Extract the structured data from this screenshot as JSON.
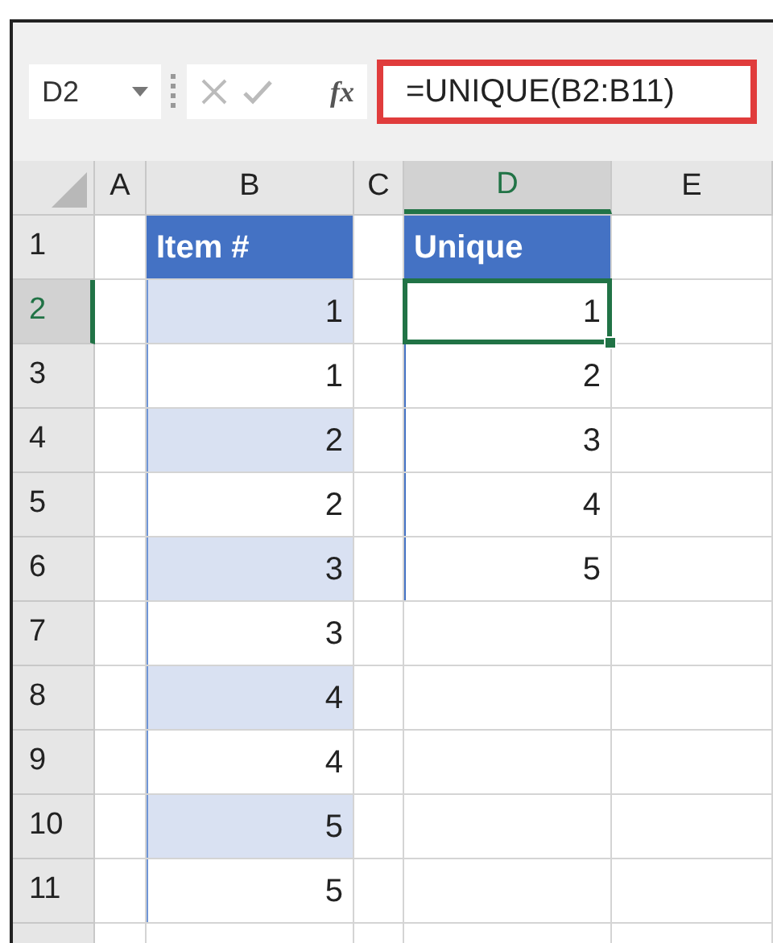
{
  "formula_bar": {
    "name_box": "D2",
    "function_label": "fx",
    "formula": "=UNIQUE(B2:B11)",
    "highlighted": true
  },
  "columns": [
    {
      "label": "A",
      "selected": false
    },
    {
      "label": "B",
      "selected": false
    },
    {
      "label": "C",
      "selected": false
    },
    {
      "label": "D",
      "selected": true
    },
    {
      "label": "E",
      "selected": false
    }
  ],
  "rows": [
    {
      "label": "1",
      "selected": false,
      "cells": [
        {
          "kind": "empty"
        },
        {
          "kind": "header",
          "text": "Item #"
        },
        {
          "kind": "empty"
        },
        {
          "kind": "header",
          "text": "Unique"
        },
        {
          "kind": "empty"
        }
      ]
    },
    {
      "label": "2",
      "selected": true,
      "cells": [
        {
          "kind": "empty"
        },
        {
          "kind": "band",
          "text": "1"
        },
        {
          "kind": "empty"
        },
        {
          "kind": "spill",
          "text": "1",
          "active": true
        },
        {
          "kind": "empty"
        }
      ]
    },
    {
      "label": "3",
      "selected": false,
      "cells": [
        {
          "kind": "empty"
        },
        {
          "kind": "plain",
          "text": "1"
        },
        {
          "kind": "empty"
        },
        {
          "kind": "spill",
          "text": "2",
          "active": false
        },
        {
          "kind": "empty"
        }
      ]
    },
    {
      "label": "4",
      "selected": false,
      "cells": [
        {
          "kind": "empty"
        },
        {
          "kind": "band",
          "text": "2"
        },
        {
          "kind": "empty"
        },
        {
          "kind": "spill",
          "text": "3",
          "active": false
        },
        {
          "kind": "empty"
        }
      ]
    },
    {
      "label": "5",
      "selected": false,
      "cells": [
        {
          "kind": "empty"
        },
        {
          "kind": "plain",
          "text": "2"
        },
        {
          "kind": "empty"
        },
        {
          "kind": "spill",
          "text": "4",
          "active": false
        },
        {
          "kind": "empty"
        }
      ]
    },
    {
      "label": "6",
      "selected": false,
      "cells": [
        {
          "kind": "empty"
        },
        {
          "kind": "band",
          "text": "3"
        },
        {
          "kind": "empty"
        },
        {
          "kind": "spill_end",
          "text": "5",
          "active": false
        },
        {
          "kind": "empty"
        }
      ]
    },
    {
      "label": "7",
      "selected": false,
      "cells": [
        {
          "kind": "empty"
        },
        {
          "kind": "plain",
          "text": "3"
        },
        {
          "kind": "empty"
        },
        {
          "kind": "empty"
        },
        {
          "kind": "empty"
        }
      ]
    },
    {
      "label": "8",
      "selected": false,
      "cells": [
        {
          "kind": "empty"
        },
        {
          "kind": "band",
          "text": "4"
        },
        {
          "kind": "empty"
        },
        {
          "kind": "empty"
        },
        {
          "kind": "empty"
        }
      ]
    },
    {
      "label": "9",
      "selected": false,
      "cells": [
        {
          "kind": "empty"
        },
        {
          "kind": "plain",
          "text": "4"
        },
        {
          "kind": "empty"
        },
        {
          "kind": "empty"
        },
        {
          "kind": "empty"
        }
      ]
    },
    {
      "label": "10",
      "selected": false,
      "cells": [
        {
          "kind": "empty"
        },
        {
          "kind": "band",
          "text": "5"
        },
        {
          "kind": "empty"
        },
        {
          "kind": "empty"
        },
        {
          "kind": "empty"
        }
      ]
    },
    {
      "label": "11",
      "selected": false,
      "cells": [
        {
          "kind": "empty"
        },
        {
          "kind": "plain_end",
          "text": "5"
        },
        {
          "kind": "empty"
        },
        {
          "kind": "empty"
        },
        {
          "kind": "empty"
        }
      ]
    }
  ]
}
